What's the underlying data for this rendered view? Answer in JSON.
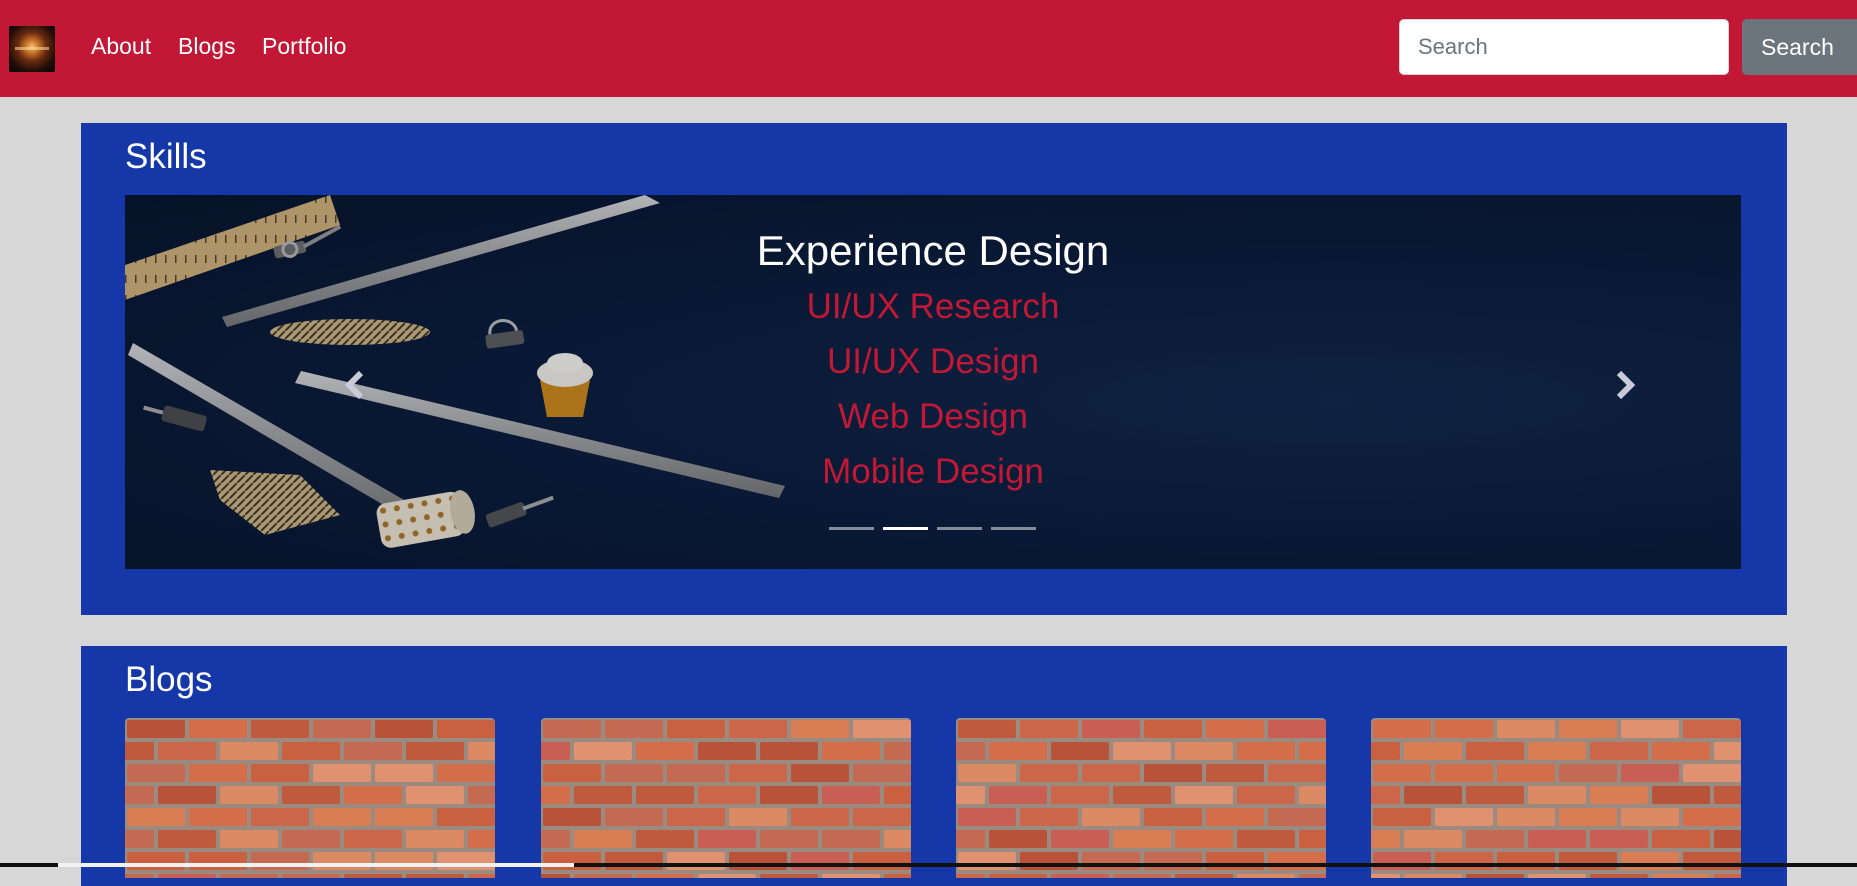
{
  "navbar": {
    "logo_icon": "fire-logo-icon",
    "links": [
      {
        "label": "About"
      },
      {
        "label": "Blogs"
      },
      {
        "label": "Portfolio"
      }
    ],
    "search": {
      "placeholder": "Search",
      "value": "",
      "button_label": "Search"
    }
  },
  "skills": {
    "title": "Skills",
    "carousel": {
      "slide_title": "Experience Design",
      "items": [
        "UI/UX Research",
        "UI/UX Design",
        "Web Design",
        "Mobile Design"
      ],
      "indicator_count": 4,
      "active_indicator": 2,
      "prev_icon": "chevron-left-icon",
      "next_icon": "chevron-right-icon",
      "background_image": "desk-tools-photo"
    }
  },
  "blogs": {
    "title": "Blogs",
    "cards": [
      {
        "image": "brick-wall-photo"
      },
      {
        "image": "brick-wall-photo"
      },
      {
        "image": "brick-wall-photo"
      },
      {
        "image": "brick-wall-photo"
      }
    ]
  },
  "colors": {
    "navbar": "#c21836",
    "panel": "#1537a7",
    "page_background": "#d7d7d7",
    "accent_text": "#c21836",
    "search_button": "#6c757d"
  }
}
